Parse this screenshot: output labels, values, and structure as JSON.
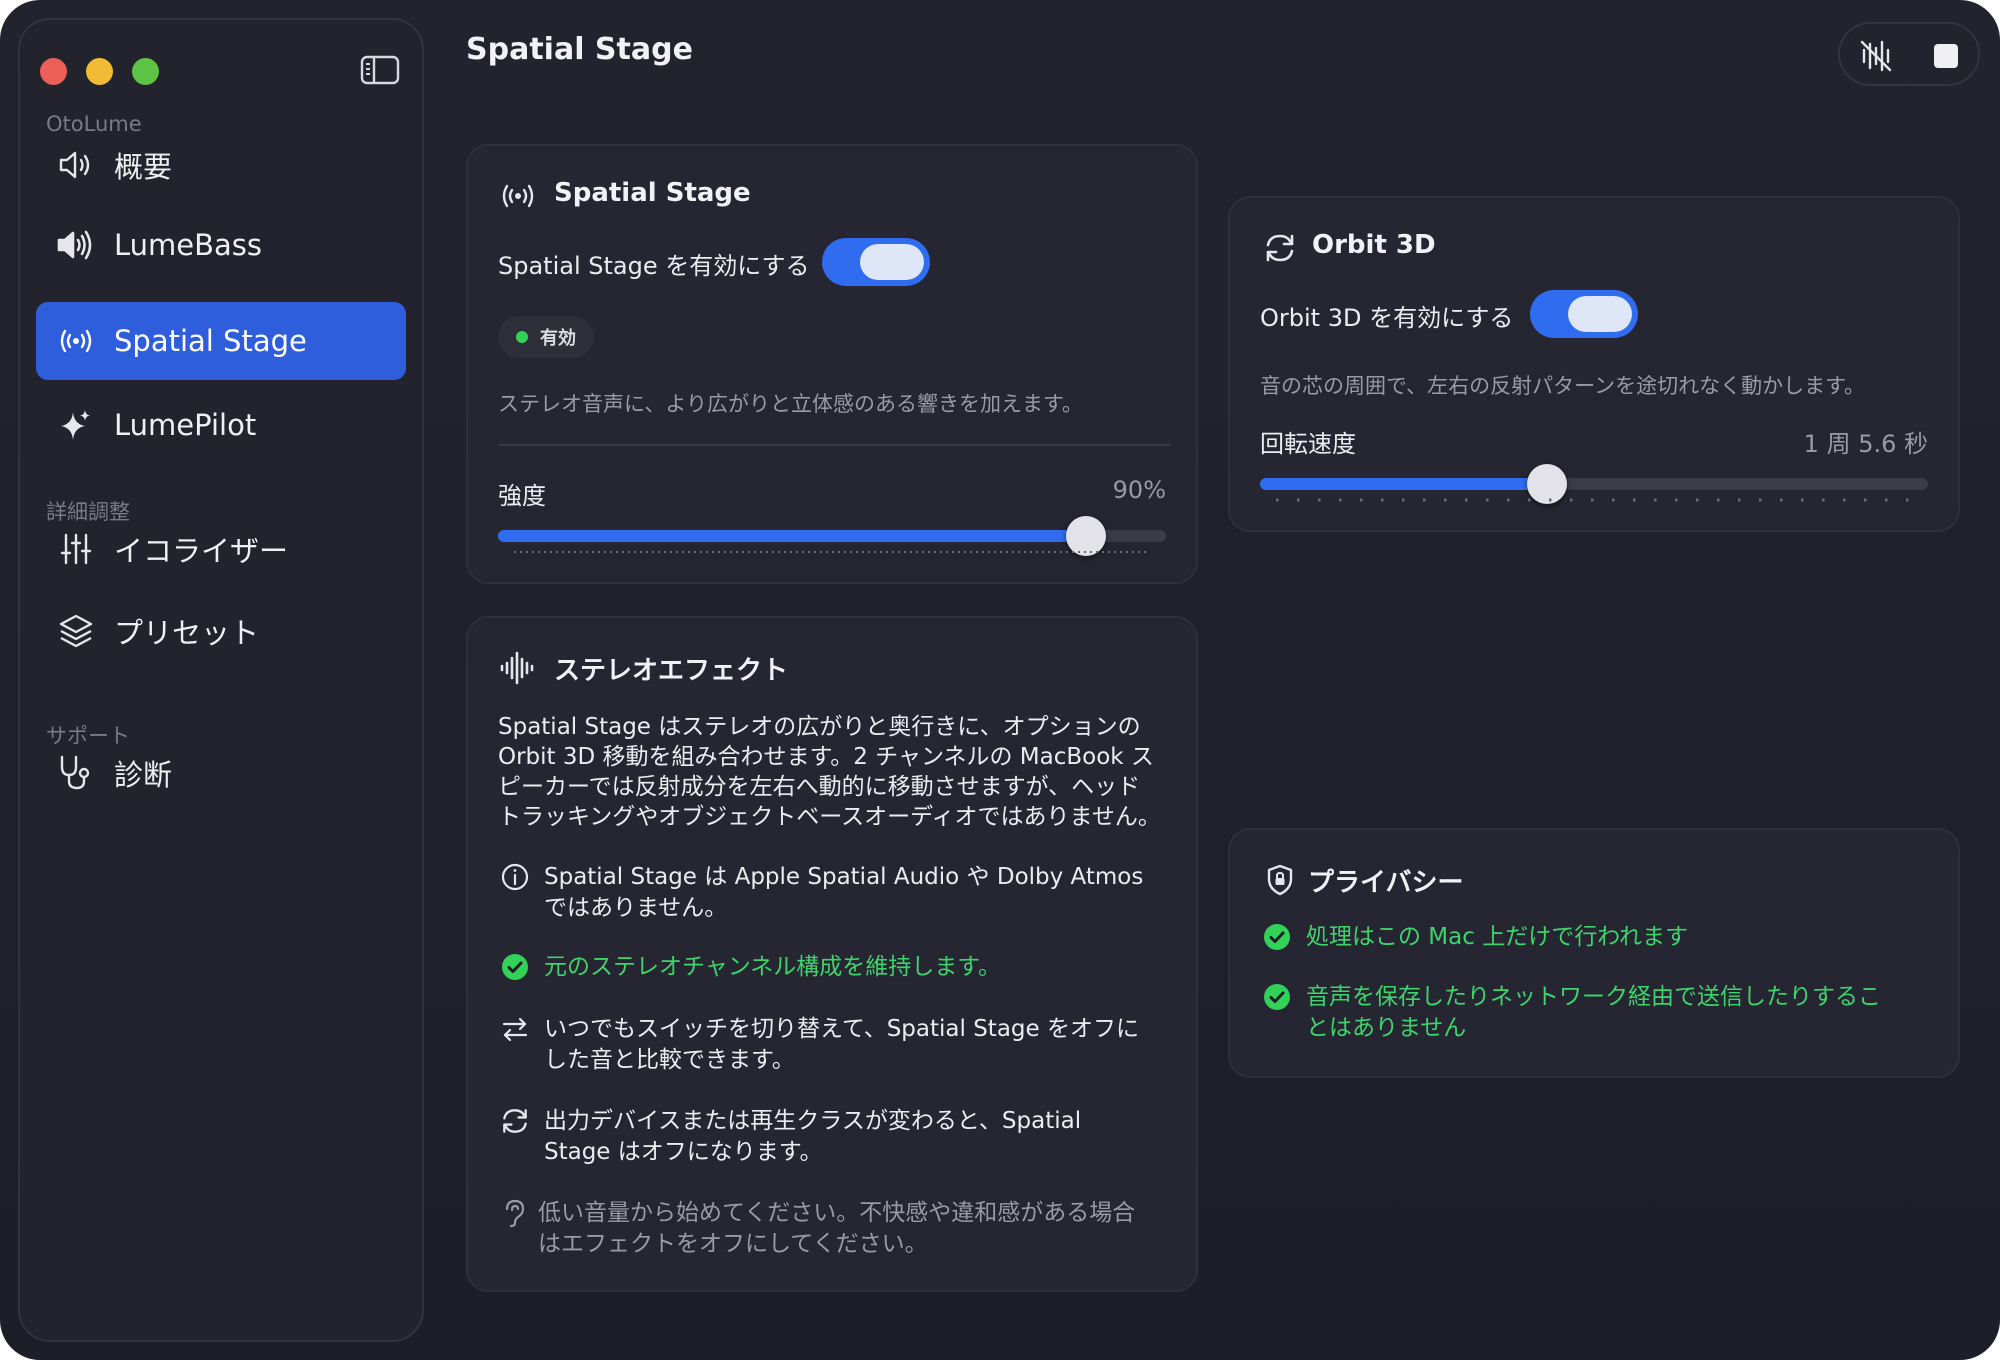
{
  "window": {
    "title": "Spatial Stage"
  },
  "sidebar": {
    "app_section": "OtoLume",
    "advanced_section": "詳細調整",
    "support_section": "サポート",
    "items": [
      {
        "label": "概要",
        "icon": "speaker-icon"
      },
      {
        "label": "LumeBass",
        "icon": "speaker-loud-icon"
      },
      {
        "label": "Spatial Stage",
        "icon": "broadcast-icon",
        "active": true
      },
      {
        "label": "LumePilot",
        "icon": "sparkle-icon"
      },
      {
        "label": "イコライザー",
        "icon": "sliders-icon"
      },
      {
        "label": "プリセット",
        "icon": "layers-icon"
      },
      {
        "label": "診断",
        "icon": "stethoscope-icon"
      }
    ]
  },
  "toolbar": {
    "mute_icon": "waveform-slash-icon",
    "stop_icon": "stop-icon"
  },
  "spatial_card": {
    "title": "Spatial Stage",
    "enable_label": "Spatial Stage を有効にする",
    "enabled": true,
    "status_badge": "有効",
    "description": "ステレオ音声に、より広がりと立体感のある響きを加えます。",
    "intensity_label": "強度",
    "intensity_value": "90%",
    "intensity_fraction": 0.88
  },
  "orbit_card": {
    "title": "Orbit 3D",
    "enable_label": "Orbit 3D を有効にする",
    "enabled": true,
    "description": "音の芯の周囲で、左右の反射パターンを途切れなく動かします。",
    "speed_label": "回転速度",
    "speed_value": "1 周 5.6 秒",
    "speed_fraction": 0.43
  },
  "stereo_card": {
    "title": "ステレオエフェクト",
    "paragraph_lines": [
      "Spatial Stage はステレオの広がりと奥行きに、オプションの",
      "Orbit 3D 移動を組み合わせます。2 チャンネルの MacBook ス",
      "ピーカーでは反射成分を左右へ動的に移動させますが、ヘッド",
      "トラッキングやオブジェクトベースオーディオではありません。"
    ],
    "items": [
      {
        "lines": [
          "Spatial Stage は Apple Spatial Audio や Dolby Atmos",
          "ではありません。"
        ],
        "icon": "info-icon",
        "tone": "normal"
      },
      {
        "lines": [
          "元のステレオチャンネル構成を維持します。"
        ],
        "icon": "check-circle-icon",
        "tone": "green"
      },
      {
        "lines": [
          "いつでもスイッチを切り替えて、Spatial Stage をオフに",
          "した音と比較できます。"
        ],
        "icon": "swap-arrows-icon",
        "tone": "normal"
      },
      {
        "lines": [
          "出力デバイスまたは再生クラスが変わると、Spatial",
          "Stage はオフになります。"
        ],
        "icon": "refresh-icon",
        "tone": "normal"
      },
      {
        "lines": [
          "低い音量から始めてください。不快感や違和感がある場合",
          "はエフェクトをオフにしてください。"
        ],
        "icon": "ear-icon",
        "tone": "muted"
      }
    ]
  },
  "privacy_card": {
    "title": "プライバシー",
    "items": [
      {
        "lines": [
          "処理はこの Mac 上だけで行われます"
        ],
        "icon": "check-circle-icon"
      },
      {
        "lines": [
          "音声を保存したりネットワーク経由で送信したりするこ",
          "とはありません"
        ],
        "icon": "check-circle-icon"
      }
    ]
  },
  "colors": {
    "accent": "#2f6cf0",
    "sidebar_active": "#2e5edb",
    "success": "#32d158",
    "background": "#1f1f29"
  }
}
